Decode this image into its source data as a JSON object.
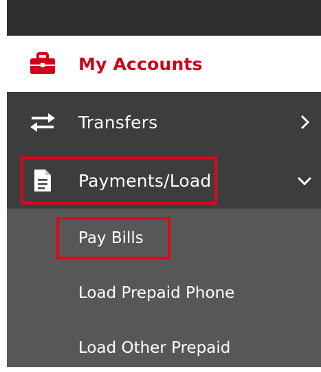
{
  "menu": {
    "my_accounts": {
      "label": "My Accounts",
      "icon": "briefcase-icon"
    },
    "transfers": {
      "label": "Transfers",
      "icon": "transfer-arrows-icon",
      "chevron": "chevron-right-icon"
    },
    "payments": {
      "label": "Payments/Load",
      "icon": "document-icon",
      "chevron": "chevron-down-icon",
      "expanded": true,
      "items": [
        {
          "label": "Pay Bills"
        },
        {
          "label": "Load Prepaid Phone"
        },
        {
          "label": "Load Other Prepaid"
        }
      ]
    }
  },
  "colors": {
    "accent": "#d0021b",
    "highlight_box": "#e0061a",
    "menu_bg": "#3d3d3d",
    "submenu_bg": "#575757",
    "topbar_bg": "#2f2f2f"
  }
}
